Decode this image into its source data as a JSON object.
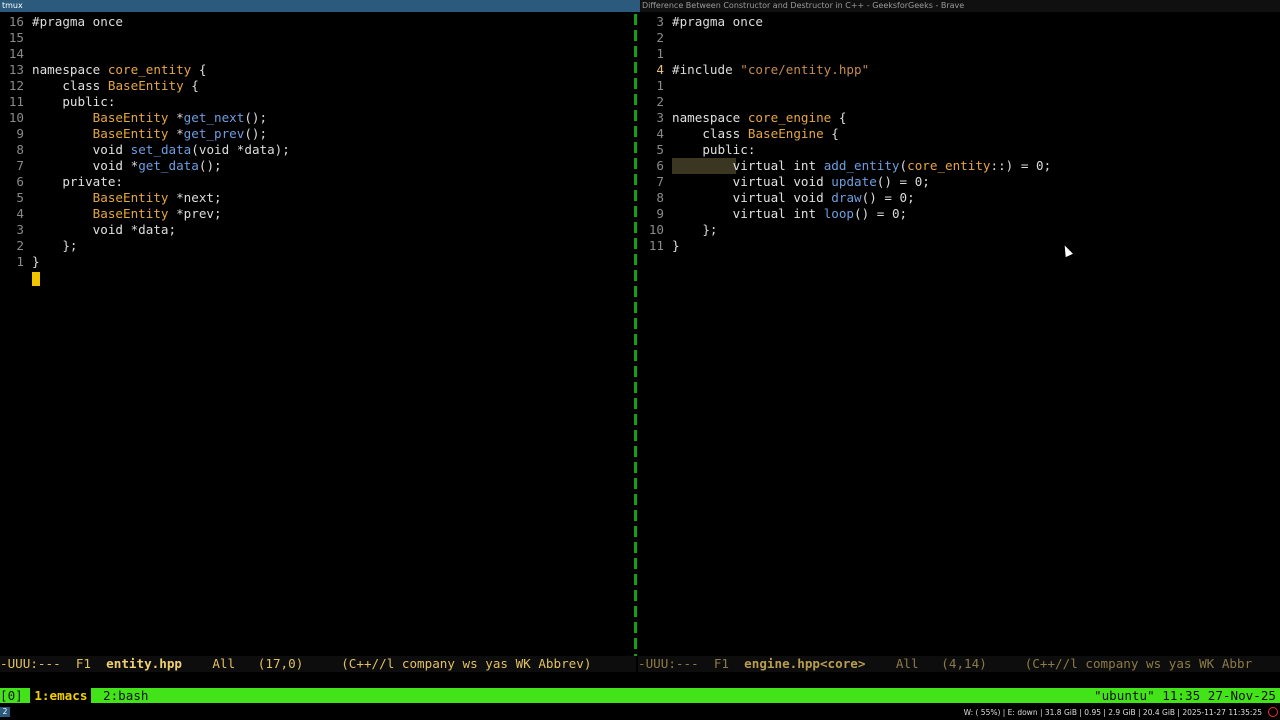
{
  "wm": {
    "left_title": "tmux",
    "right_title": "Difference Between Constructor and Destructor in C++ - GeeksforGeeks - Brave"
  },
  "left_pane": {
    "lines": [
      {
        "n": "16",
        "t": "#pragma once"
      },
      {
        "n": "15",
        "t": ""
      },
      {
        "n": "14",
        "t": ""
      },
      {
        "n": "13",
        "t": "namespace core_entity {"
      },
      {
        "n": "12",
        "t": "    class BaseEntity {"
      },
      {
        "n": "11",
        "t": "    public:"
      },
      {
        "n": "10",
        "t": "        BaseEntity *get_next();"
      },
      {
        "n": "9",
        "t": "        BaseEntity *get_prev();"
      },
      {
        "n": "8",
        "t": "        void set_data(void *data);"
      },
      {
        "n": "7",
        "t": "        void *get_data();"
      },
      {
        "n": "6",
        "t": "    private:"
      },
      {
        "n": "5",
        "t": "        BaseEntity *next;"
      },
      {
        "n": "4",
        "t": "        BaseEntity *prev;"
      },
      {
        "n": "3",
        "t": "        void *data;"
      },
      {
        "n": "2",
        "t": "    };"
      },
      {
        "n": "1",
        "t": "}"
      }
    ]
  },
  "right_pane": {
    "lines": [
      {
        "n": "3",
        "t": "#pragma once"
      },
      {
        "n": "2",
        "t": ""
      },
      {
        "n": "1",
        "t": ""
      },
      {
        "n": "4",
        "t": "#include \"core/entity.hpp\""
      },
      {
        "n": "1",
        "t": ""
      },
      {
        "n": "2",
        "t": ""
      },
      {
        "n": "3",
        "t": "namespace core_engine {"
      },
      {
        "n": "4",
        "t": "    class BaseEngine {"
      },
      {
        "n": "5",
        "t": "    public:"
      },
      {
        "n": "6",
        "t": "        virtual int add_entity(core_entity::) = 0;"
      },
      {
        "n": "7",
        "t": "        virtual void update() = 0;"
      },
      {
        "n": "8",
        "t": "        virtual void draw() = 0;"
      },
      {
        "n": "9",
        "t": "        virtual int loop() = 0;"
      },
      {
        "n": "10",
        "t": "    };"
      },
      {
        "n": "11",
        "t": "}"
      }
    ]
  },
  "modeline_left": {
    "state": "-UUU:---  F1  ",
    "buffer": "entity.hpp",
    "position": "    All   (17,0)     (C++//l company ws yas WK Abbrev)"
  },
  "modeline_right": {
    "state": "-UUU:---  F1  ",
    "buffer": "engine.hpp<core>",
    "position": "    All   (4,14)     (C++//l company ws yas WK Abbr"
  },
  "tmux": {
    "session": "[0]",
    "windows": [
      {
        "label": "1:emacs",
        "active": true
      },
      {
        "label": "2:bash",
        "active": false
      }
    ],
    "status_right": "\"ubuntu\" 11:35 27-Nov-25"
  },
  "bottom_bar": {
    "workspace": "2",
    "stats": "W: ( 55%) | E: down | 31.8 GiB | 0.95 | 2.9 GiB | 20.4 GiB | 2025-11-27 11:35:25"
  },
  "colors": {
    "divider": "#13a113",
    "tmux_bar": "#43e31a",
    "active_window": "#f0d000",
    "cursor": "#f2c400"
  }
}
